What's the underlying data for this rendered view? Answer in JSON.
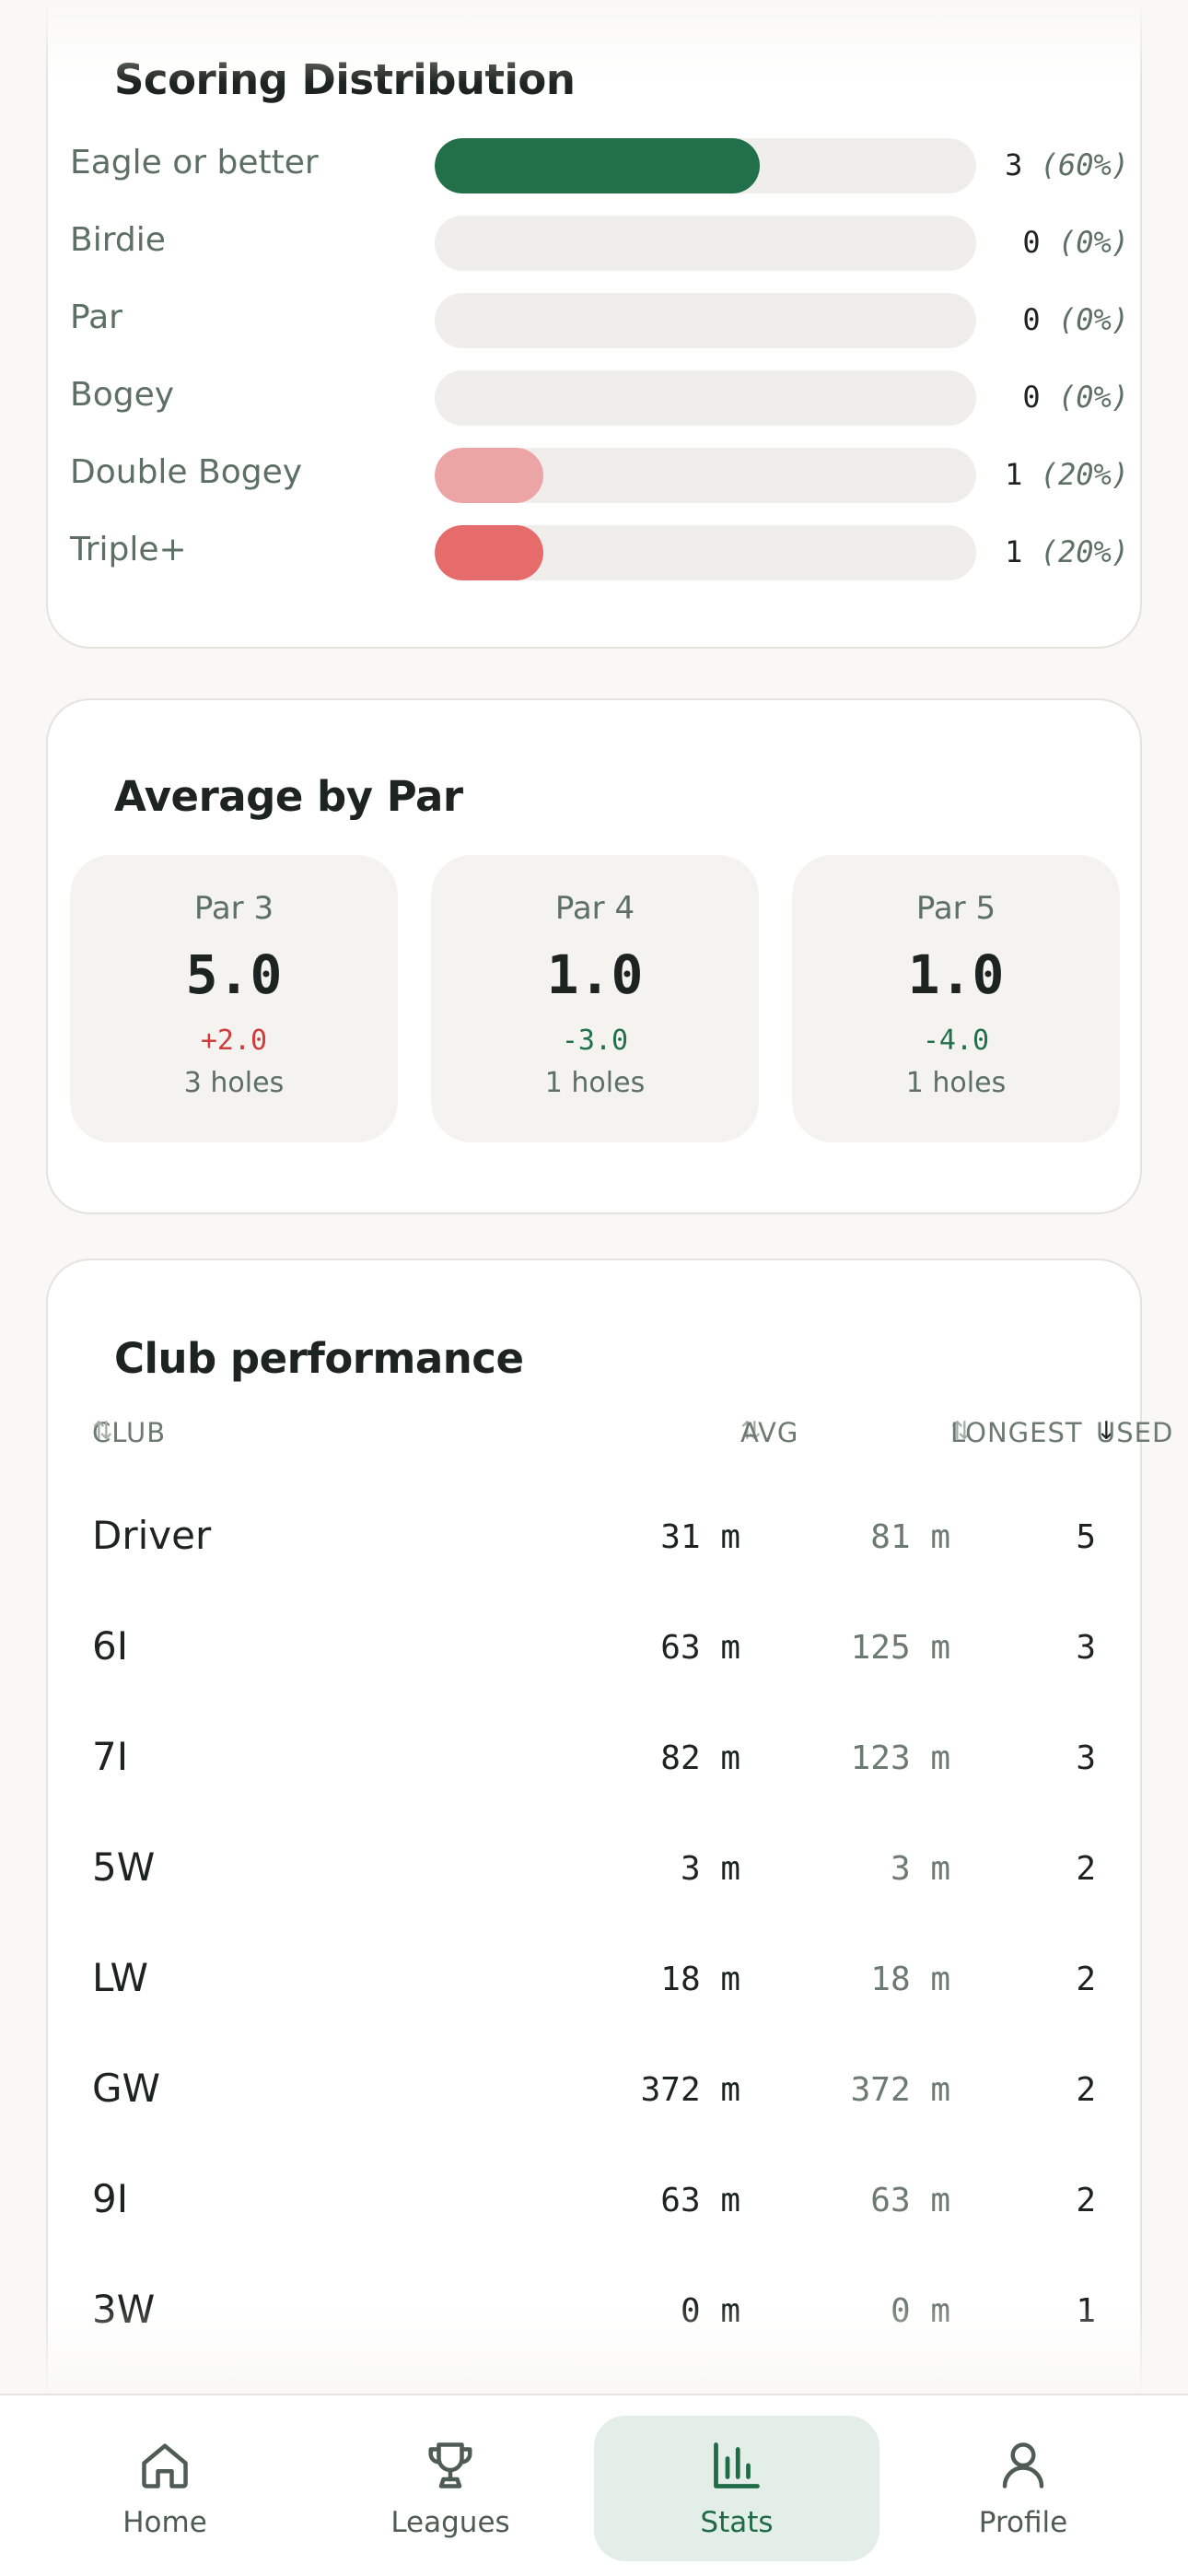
{
  "colors": {
    "accent": "#21704a",
    "double_bogey": "#eba5a5",
    "triple": "#e66b6b",
    "over_par": "#d03b3b",
    "under_par": "#21704a"
  },
  "distribution": {
    "title": "Scoring Distribution",
    "rows": [
      {
        "label": "Eagle or better",
        "count": "3",
        "pct": "(60%)",
        "fraction": 0.6,
        "color": "#21704a"
      },
      {
        "label": "Birdie",
        "count": "0",
        "pct": "(0%)",
        "fraction": 0,
        "color": "#21704a"
      },
      {
        "label": "Par",
        "count": "0",
        "pct": "(0%)",
        "fraction": 0,
        "color": "#21704a"
      },
      {
        "label": "Bogey",
        "count": "0",
        "pct": "(0%)",
        "fraction": 0,
        "color": "#21704a"
      },
      {
        "label": "Double Bogey",
        "count": "1",
        "pct": "(20%)",
        "fraction": 0.2,
        "color": "#eba5a5"
      },
      {
        "label": "Triple+",
        "count": "1",
        "pct": "(20%)",
        "fraction": 0.2,
        "color": "#e66b6b"
      }
    ]
  },
  "average_by_par": {
    "title": "Average by Par",
    "items": [
      {
        "name": "Par 3",
        "avg": "5.0",
        "diff": "+2.0",
        "holes": "3 holes",
        "trend": "over"
      },
      {
        "name": "Par 4",
        "avg": "1.0",
        "diff": "-3.0",
        "holes": "1 holes",
        "trend": "under"
      },
      {
        "name": "Par 5",
        "avg": "1.0",
        "diff": "-4.0",
        "holes": "1 holes",
        "trend": "under"
      }
    ]
  },
  "clubs": {
    "title": "Club performance",
    "headers": {
      "club": "CLUB",
      "avg": "AVG",
      "longest": "LONGEST",
      "used": "USED"
    },
    "sort_icons": {
      "club": "⇅",
      "avg": "⇅",
      "longest": "⇅",
      "used": "↓"
    },
    "rows": [
      {
        "club": "Driver",
        "avg": "31 m",
        "longest": "81 m",
        "used": "5"
      },
      {
        "club": "6I",
        "avg": "63 m",
        "longest": "125 m",
        "used": "3"
      },
      {
        "club": "7I",
        "avg": "82 m",
        "longest": "123 m",
        "used": "3"
      },
      {
        "club": "5W",
        "avg": "3 m",
        "longest": "3 m",
        "used": "2"
      },
      {
        "club": "LW",
        "avg": "18 m",
        "longest": "18 m",
        "used": "2"
      },
      {
        "club": "GW",
        "avg": "372 m",
        "longest": "372 m",
        "used": "2"
      },
      {
        "club": "9I",
        "avg": "63 m",
        "longest": "63 m",
        "used": "2"
      },
      {
        "club": "3W",
        "avg": "0 m",
        "longest": "0 m",
        "used": "1"
      }
    ]
  },
  "tabbar": {
    "tabs": [
      {
        "label": "Home",
        "icon": "home-icon",
        "active": false
      },
      {
        "label": "Leagues",
        "icon": "trophy-icon",
        "active": false
      },
      {
        "label": "Stats",
        "icon": "bar-chart-icon",
        "active": true
      },
      {
        "label": "Profile",
        "icon": "user-icon",
        "active": false
      }
    ]
  }
}
